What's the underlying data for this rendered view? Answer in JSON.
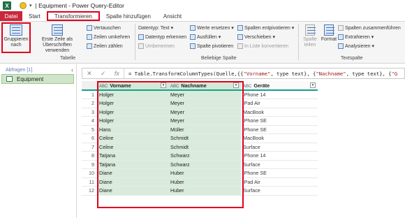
{
  "titlebar": {
    "app_logo": "X",
    "title": "| Equipment - Power Query-Editor"
  },
  "tabs": [
    "Datei",
    "Start",
    "Transformieren",
    "Spalte hinzufügen",
    "Ansicht"
  ],
  "ribbon": {
    "group_btn": "Gruppieren nach",
    "first_row": "Erste Zeile als Überschriften verwenden",
    "swap": "Vertauschen",
    "reverse": "Zeilen umkehren",
    "count": "Zeilen zählen",
    "table_group": "Tabelle",
    "datatype": "Datentyp: Text",
    "detect": "Datentyp erkennen",
    "rename": "Umbenennen",
    "replace": "Werte ersetzen",
    "fill": "Ausfüllen",
    "pivot": "Spalte pivotieren",
    "unpivot": "Spalten entpivotieren",
    "move": "Verschieben",
    "tolist": "In Liste konvertieren",
    "any_group": "Beliebige Spalte",
    "split": "Spalte teilen",
    "format": "Format",
    "merge": "Spalten zusammenführen",
    "extract": "Extrahieren",
    "analyze": "Analysieren",
    "text_group": "Textspalte"
  },
  "queries": {
    "header": "Abfragen [1]",
    "item": "Equipment"
  },
  "formula": {
    "prefix": "= Table.TransformColumnTypes(Quelle,{{",
    "s1": "\"Vorname\"",
    "mid1": ", type text}, {",
    "s2": "\"Nachname\"",
    "mid2": ", type text}, {",
    "s3": "\"G"
  },
  "grid": {
    "type_label": "ABC",
    "columns": [
      "Vorname",
      "Nachname",
      "Geräte"
    ],
    "rows": [
      [
        "1",
        "Holger",
        "Meyer",
        "iPhone 14"
      ],
      [
        "2",
        "Holger",
        "Meyer",
        "iPad Air"
      ],
      [
        "3",
        "Holger",
        "Meyer",
        "MacBook"
      ],
      [
        "4",
        "Holger",
        "Meyer",
        "iPhone SE"
      ],
      [
        "5",
        "Hans",
        "Müller",
        "iPhone SE"
      ],
      [
        "6",
        "Celine",
        "Schmidt",
        "MacBook"
      ],
      [
        "7",
        "Celine",
        "Schmidt",
        "Surface"
      ],
      [
        "8",
        "Tatjana",
        "Schwarz",
        "iPhone 14"
      ],
      [
        "9",
        "Tatjana",
        "Schwarz",
        "Surface"
      ],
      [
        "10",
        "Diane",
        "Huber",
        "iPhone SE"
      ],
      [
        "11",
        "Diane",
        "Huber",
        "iPad Air"
      ],
      [
        "12",
        "Diane",
        "Huber",
        "Surface"
      ]
    ]
  }
}
